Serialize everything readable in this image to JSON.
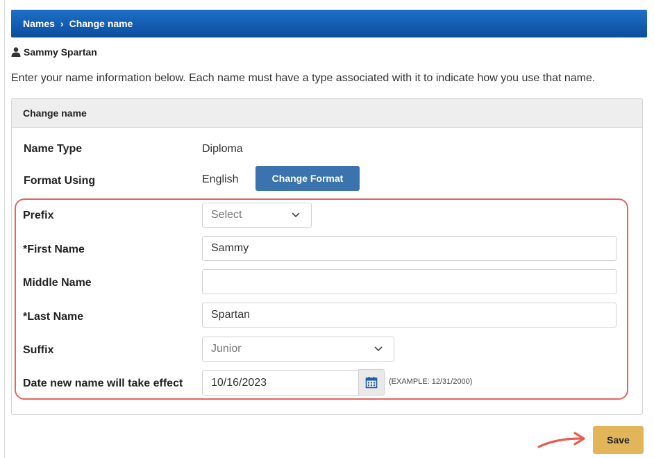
{
  "breadcrumb": {
    "parent": "Names",
    "separator": "›",
    "current": "Change name"
  },
  "user": {
    "name": "Sammy Spartan",
    "icon": "user-icon"
  },
  "intro": "Enter your name information below. Each name must have a type associated with it to indicate how you use that name.",
  "panel": {
    "title": "Change name",
    "name_type_label": "Name Type",
    "name_type_value": "Diploma",
    "format_label": "Format Using",
    "format_value": "English",
    "change_format_button": "Change Format"
  },
  "form": {
    "prefix": {
      "label": "Prefix",
      "value": "Select"
    },
    "first_name": {
      "label": "*First Name",
      "value": "Sammy"
    },
    "middle_name": {
      "label": "Middle Name",
      "value": ""
    },
    "last_name": {
      "label": "*Last Name",
      "value": "Spartan"
    },
    "suffix": {
      "label": "Suffix",
      "value": "Junior"
    },
    "effective_date": {
      "label": "Date new name will take effect",
      "value": "10/16/2023",
      "example": "(EXAMPLE: 12/31/2000)"
    }
  },
  "save_button": "Save",
  "colors": {
    "header": "#0b4d9d",
    "button": "#3a73ad",
    "save": "#e3b55b",
    "highlight": "#e8625a"
  }
}
